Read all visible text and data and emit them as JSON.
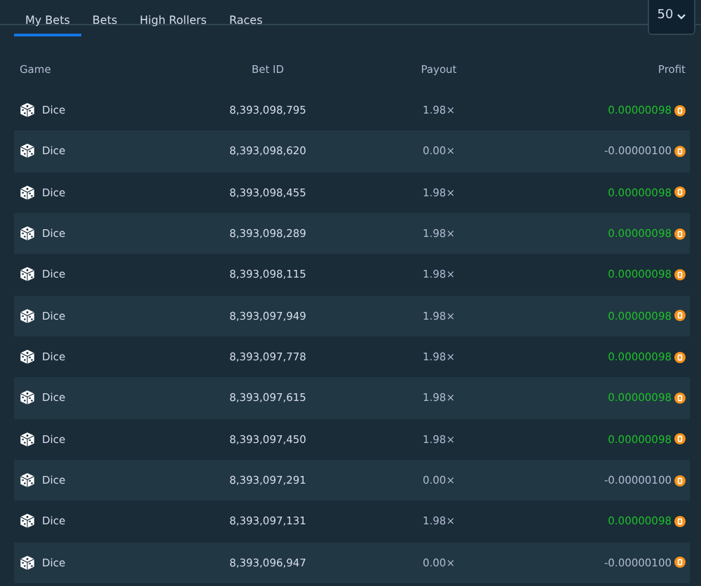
{
  "tabs": [
    {
      "label": "My Bets",
      "selected": true
    },
    {
      "label": "Bets",
      "selected": false
    },
    {
      "label": "High Rollers",
      "selected": false
    },
    {
      "label": "Races",
      "selected": false
    }
  ],
  "page_size": {
    "value": "50"
  },
  "table": {
    "columns": [
      "Game",
      "Bet ID",
      "Payout",
      "Profit"
    ],
    "rows": [
      {
        "game": "Dice",
        "bet_id": "8,393,098,795",
        "payout": "1.98×",
        "profit": "0.00000098",
        "won": true
      },
      {
        "game": "Dice",
        "bet_id": "8,393,098,620",
        "payout": "0.00×",
        "profit": "-0.00000100",
        "won": false
      },
      {
        "game": "Dice",
        "bet_id": "8,393,098,455",
        "payout": "1.98×",
        "profit": "0.00000098",
        "won": true
      },
      {
        "game": "Dice",
        "bet_id": "8,393,098,289",
        "payout": "1.98×",
        "profit": "0.00000098",
        "won": true
      },
      {
        "game": "Dice",
        "bet_id": "8,393,098,115",
        "payout": "1.98×",
        "profit": "0.00000098",
        "won": true
      },
      {
        "game": "Dice",
        "bet_id": "8,393,097,949",
        "payout": "1.98×",
        "profit": "0.00000098",
        "won": true
      },
      {
        "game": "Dice",
        "bet_id": "8,393,097,778",
        "payout": "1.98×",
        "profit": "0.00000098",
        "won": true
      },
      {
        "game": "Dice",
        "bet_id": "8,393,097,615",
        "payout": "1.98×",
        "profit": "0.00000098",
        "won": true
      },
      {
        "game": "Dice",
        "bet_id": "8,393,097,450",
        "payout": "1.98×",
        "profit": "0.00000098",
        "won": true
      },
      {
        "game": "Dice",
        "bet_id": "8,393,097,291",
        "payout": "0.00×",
        "profit": "-0.00000100",
        "won": false
      },
      {
        "game": "Dice",
        "bet_id": "8,393,097,131",
        "payout": "1.98×",
        "profit": "0.00000098",
        "won": true
      },
      {
        "game": "Dice",
        "bet_id": "8,393,096,947",
        "payout": "0.00×",
        "profit": "-0.00000100",
        "won": false
      }
    ]
  }
}
